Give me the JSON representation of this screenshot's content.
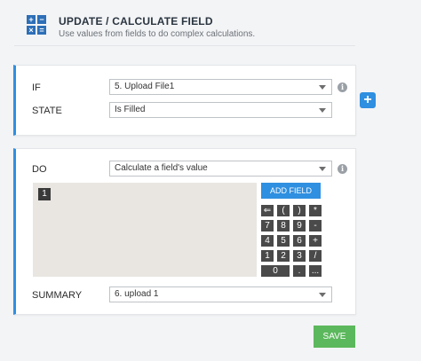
{
  "header": {
    "title": "UPDATE / CALCULATE FIELD",
    "subtitle": "Use values from fields to do complex calculations.",
    "icon_glyphs": [
      "+",
      "−",
      "×",
      "="
    ],
    "icon": "calculator-icon"
  },
  "condition": {
    "if_label": "IF",
    "if_value": "5. Upload File1",
    "state_label": "STATE",
    "state_value": "Is Filled"
  },
  "action": {
    "do_label": "DO",
    "do_value": "Calculate a field's value",
    "token": "1",
    "add_field_label": "ADD FIELD",
    "keypad": [
      "⇐",
      "(",
      ")",
      "*",
      "7",
      "8",
      "9",
      "-",
      "4",
      "5",
      "6",
      "+",
      "1",
      "2",
      "3",
      "/",
      "0",
      ".",
      "..."
    ],
    "summary_label": "SUMMARY",
    "summary_value": "6. upload 1"
  },
  "buttons": {
    "save": "SAVE",
    "add_condition": "+",
    "info": "i"
  },
  "colors": {
    "accent": "#2f8fe0",
    "save": "#5cb85c",
    "key": "#4a4a4a"
  }
}
